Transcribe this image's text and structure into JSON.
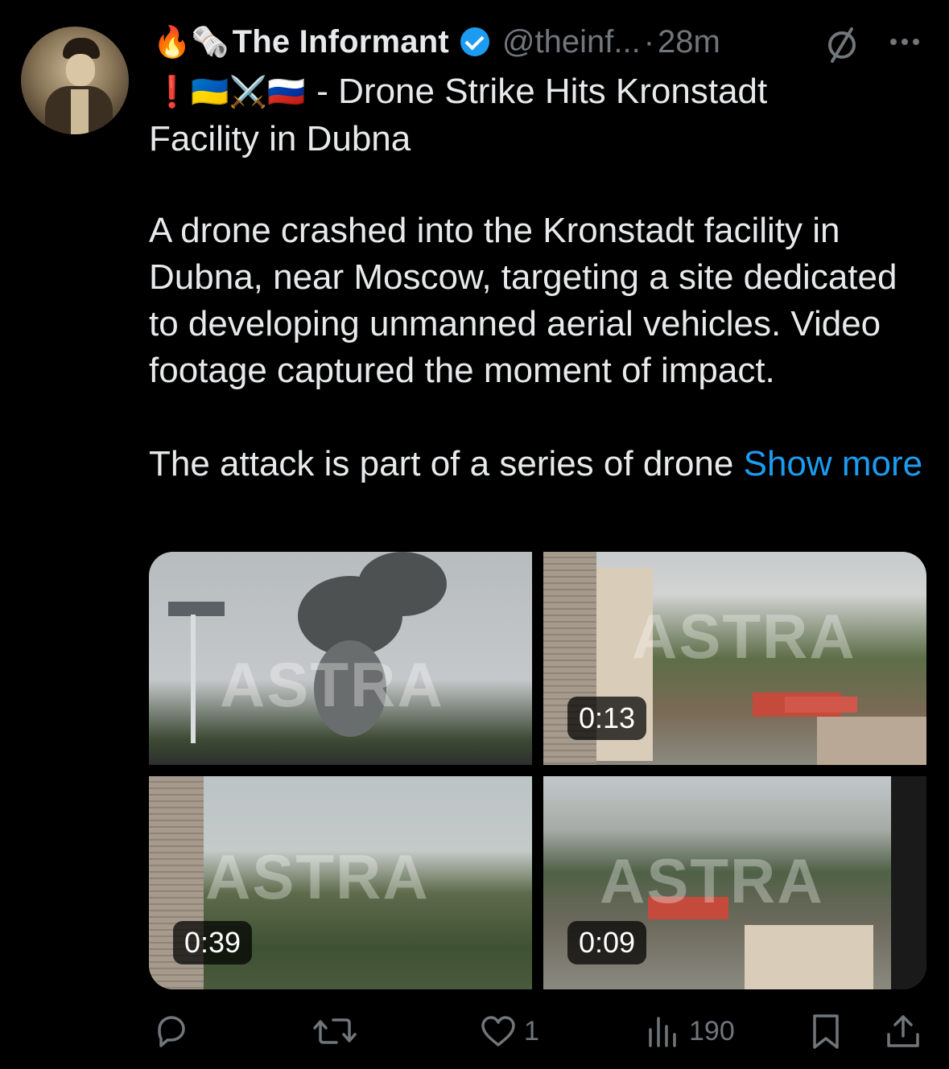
{
  "author": {
    "name": "The Informant",
    "handle": "@theinf...",
    "separator": "·",
    "time": "28m",
    "name_emoji": "🔥🗞️",
    "verified": true
  },
  "post": {
    "title_emoji": "❗🇺🇦⚔️🇷🇺",
    "title_text": "- Drone Strike Hits Kronstadt",
    "title_line2": "Facility in Dubna",
    "paragraph1": "A drone crashed into the Kronstadt facility in Dubna, near Moscow, targeting a site dedicated to developing unmanned aerial vehicles. Video footage captured the moment of impact.",
    "paragraph2": "The attack is part of a series of drone ",
    "show_more_label": "Show more"
  },
  "media": {
    "watermark": "ASTRA",
    "tiles": [
      {
        "duration": ""
      },
      {
        "duration": "0:13"
      },
      {
        "duration": "0:39"
      },
      {
        "duration": "0:09"
      }
    ]
  },
  "actions": {
    "reply_count": "",
    "repost_count": "",
    "like_count": "1",
    "views_count": "190"
  },
  "colors": {
    "background": "#000000",
    "text": "#e7e9ea",
    "muted": "#71767b",
    "link": "#1d9bf0",
    "verified": "#1d9bf0"
  },
  "icons": {
    "grok": "slashed-circle-icon",
    "more": "more-dots-icon",
    "reply": "reply-icon",
    "repost": "repost-icon",
    "like": "heart-icon",
    "views": "views-bar-icon",
    "bookmark": "bookmark-icon",
    "share": "share-icon"
  }
}
